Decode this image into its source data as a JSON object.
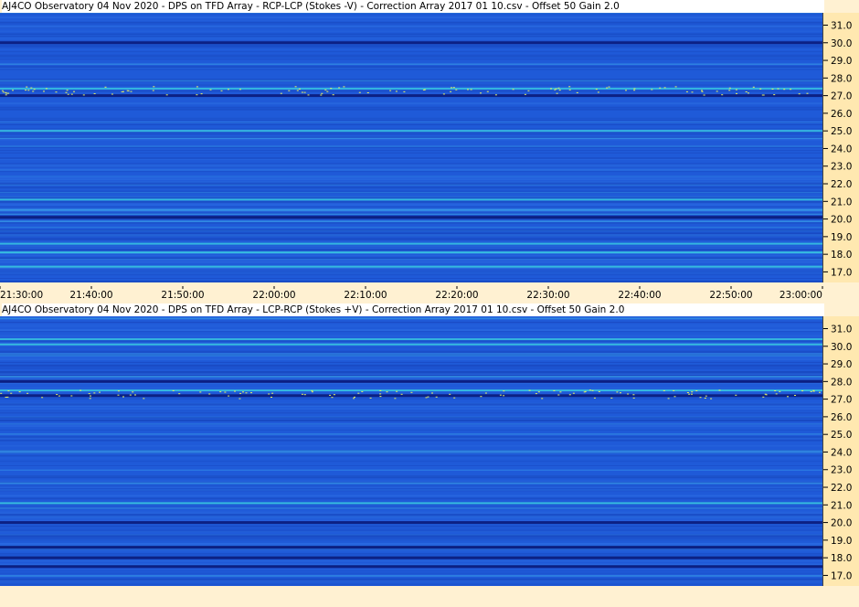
{
  "panels": [
    {
      "title": "AJ4CO Observatory 04 Nov 2020  -  DPS on TFD Array  -  RCP-LCP (Stokes -V)  -  Correction Array 2017 01 10.csv  -  Offset 50  Gain 2.0",
      "bright_bands": [
        17.3,
        18.1,
        18.6,
        21.1,
        25.0,
        27.4
      ],
      "dark_bands": [
        20.1,
        27.0,
        30.0
      ]
    },
    {
      "title": "AJ4CO Observatory 04 Nov 2020  -  DPS on TFD Array  -  LCP-RCP (Stokes +V)  -  Correction Array 2017 01 10.csv  -  Offset 50  Gain 2.0",
      "bright_bands": [
        21.1,
        27.5,
        30.1,
        30.4
      ],
      "dark_bands": [
        17.5,
        18.0,
        18.6,
        20.0,
        27.2,
        28.0
      ]
    }
  ],
  "chart_data": {
    "type": "heatmap",
    "y_ticks": [
      "17.0",
      "18.0",
      "19.0",
      "20.0",
      "21.0",
      "22.0",
      "23.0",
      "24.0",
      "25.0",
      "26.0",
      "27.0",
      "28.0",
      "29.0",
      "30.0",
      "31.0"
    ],
    "ylim": [
      16.4,
      31.7
    ],
    "x_ticks": [
      "21:30:00",
      "21:40:00",
      "21:50:00",
      "22:00:00",
      "22:10:00",
      "22:20:00",
      "22:30:00",
      "22:40:00",
      "22:50:00",
      "23:00:00"
    ],
    "xlim": [
      "21:30:00",
      "23:00:00"
    ],
    "colors": {
      "base": "#1f5ad8",
      "dark": "#0a1a7a",
      "bright": "#38c8e0",
      "hot": "#e8f060"
    }
  }
}
